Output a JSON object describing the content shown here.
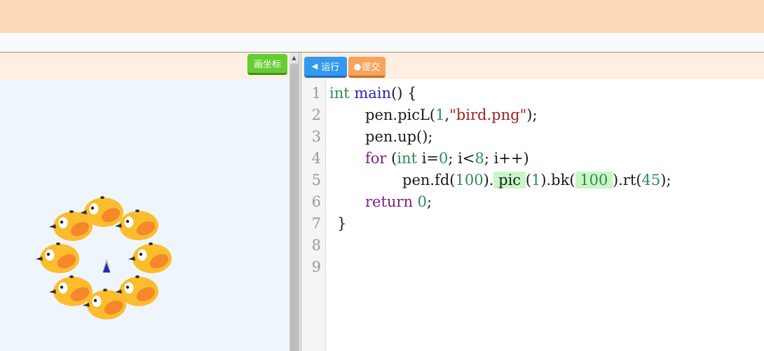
{
  "toolbar": {
    "coord_button_label": "画坐标",
    "run_button_label": "运行",
    "submit_button_label": "提交"
  },
  "editor": {
    "line_numbers": [
      "1",
      "2",
      "3",
      "4",
      "5",
      "6",
      "7",
      "8",
      "9"
    ],
    "code": {
      "l1_type": "int",
      "l1_fn": "main",
      "l1_rest": "() {",
      "l2_a": "pen.picL(",
      "l2_num": "1",
      "l2_comma": ",",
      "l2_str": "\"bird.png\"",
      "l2_end": ");",
      "l3": "pen.up();",
      "l4_for": "for",
      "l4_paren": " (",
      "l4_int": "int",
      "l4_i": " i=",
      "l4_zero": "0",
      "l4_cond": "; i<",
      "l4_eight": "8",
      "l4_end": "; i++)",
      "l5_a": "pen.fd(",
      "l5_100a": "100",
      "l5_b": ").",
      "l5_pic": " pic ",
      "l5_c": "(",
      "l5_one": "1",
      "l5_d": ").bk(",
      "l5_100b": " 100 ",
      "l5_e": ").rt(",
      "l5_45": "45",
      "l5_f": ");",
      "l6_ret": "return",
      "l6_zero": " 0",
      "l6_end": ";",
      "l7": "}"
    }
  },
  "canvas": {
    "sprite_count": 8,
    "sprite_name": "bird-sprite",
    "background_color": "#eef6fb"
  },
  "colors": {
    "header": "#fed9b7",
    "toolbar": "#ffeee2",
    "coord_button": "#66cc33",
    "run_button": "#3399ee",
    "submit_button": "#f6a35e",
    "highlight": "#c8f7c5"
  }
}
